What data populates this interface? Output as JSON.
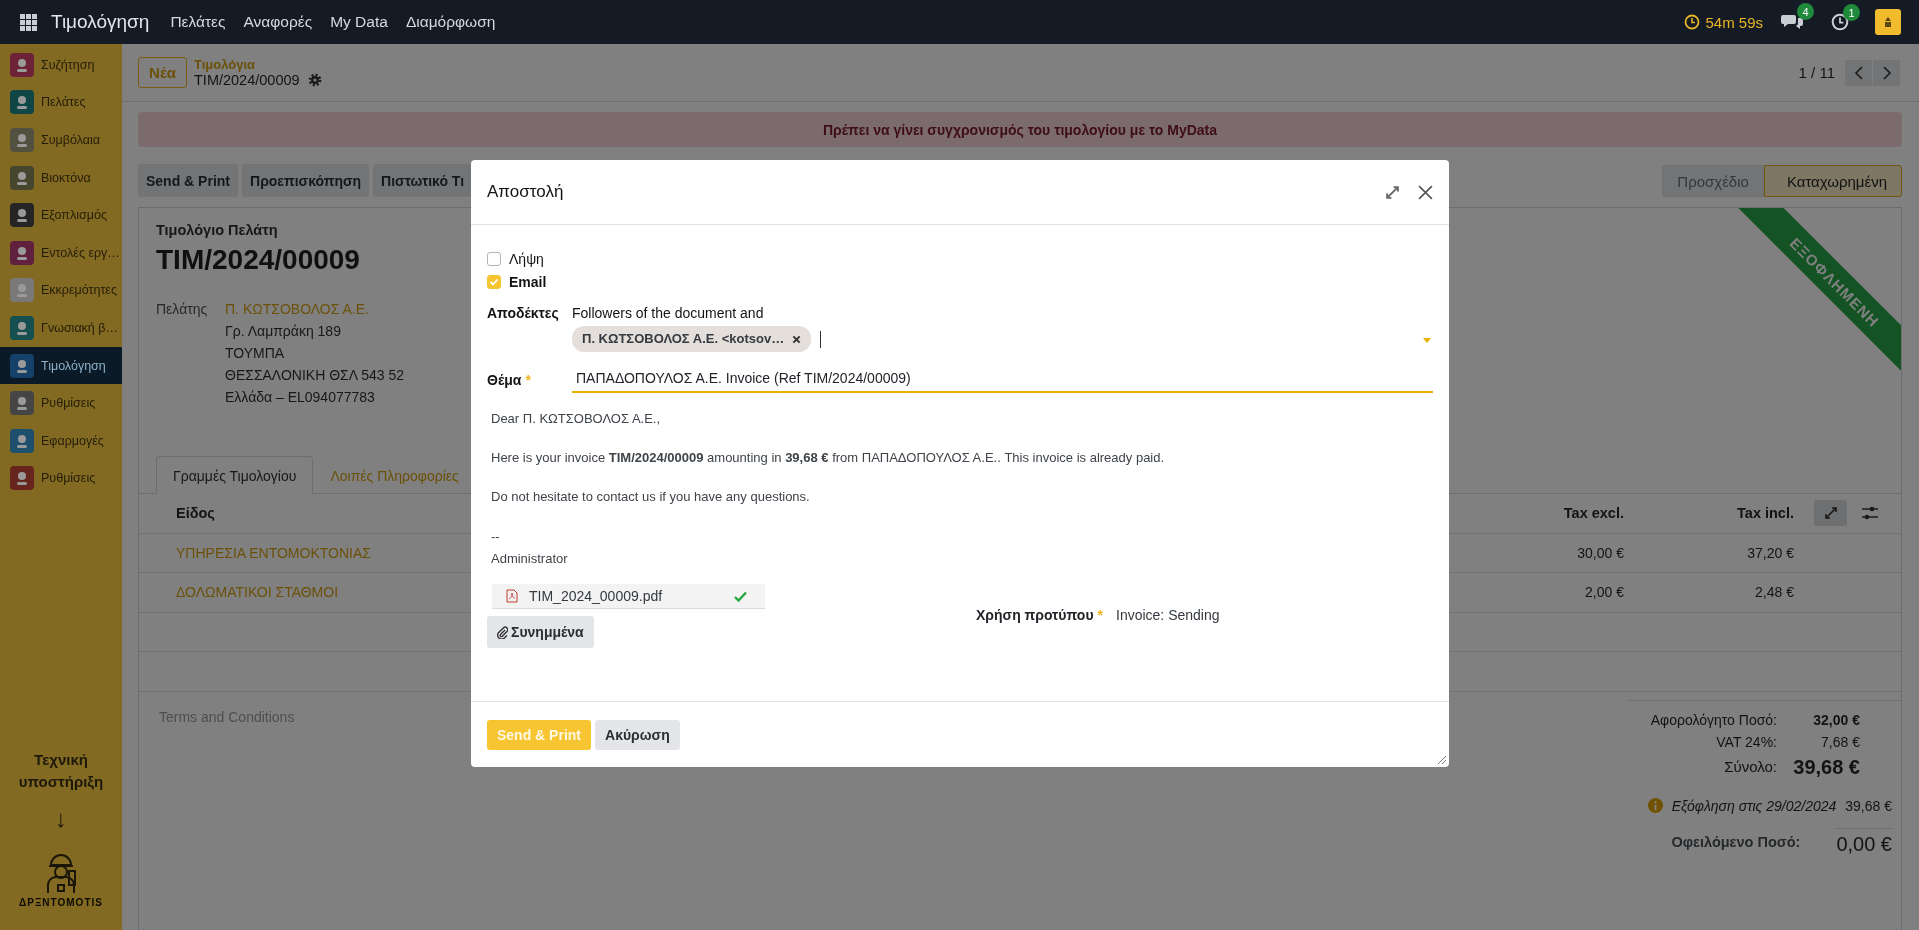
{
  "topbar": {
    "app_name": "Τιμολόγηση",
    "menu": [
      "Πελάτες",
      "Αναφορές",
      "My Data",
      "Διαμόρφωση"
    ],
    "timer": "54m 59s",
    "messages_count": "4",
    "activities_count": "1"
  },
  "sidebar": {
    "items": [
      {
        "label": "Συζήτηση",
        "selected": false,
        "color": "#6d2238"
      },
      {
        "label": "Πελάτες",
        "selected": false,
        "color": "#0f4646"
      },
      {
        "label": "Συμβόλαια",
        "selected": false,
        "color": "#52503e"
      },
      {
        "label": "Βιοκτόνα",
        "selected": false,
        "color": "#46452d"
      },
      {
        "label": "Εξοπλισμός",
        "selected": false,
        "color": "#252525"
      },
      {
        "label": "Εντολές εργ…",
        "selected": false,
        "color": "#61203d"
      },
      {
        "label": "Εκκρεμότητες",
        "selected": false,
        "color": "#797979"
      },
      {
        "label": "Γνωσιακή β…",
        "selected": false,
        "color": "#154f4f"
      },
      {
        "label": "Τιμολόγηση",
        "selected": true,
        "color": "#154069"
      },
      {
        "label": "Ρυθμίσεις",
        "selected": false,
        "color": "#454545"
      },
      {
        "label": "Εφαρμογές",
        "selected": false,
        "color": "#1d506c"
      },
      {
        "label": "Ρυθμίσεις",
        "selected": false,
        "color": "#68251d"
      }
    ],
    "support_text": "Τεχνική υποστήριξη",
    "support_arrow": "↓",
    "logo_text": "ΔΡΞΝΤΟΜΟΤΙS"
  },
  "control_panel": {
    "new_button": "Νέα",
    "breadcrumb_parent": "Τιμολόγια",
    "record_name": "TIM/2024/00009",
    "pager": "1 / 11"
  },
  "alert": "Πρέπει να γίνει συγχρονισμός του τιμολογίου με το MyData",
  "action_buttons": [
    "Send & Print",
    "Προεπισκόπηση",
    "Πιστωτικό Τι"
  ],
  "status": [
    {
      "label": "Προσχέδιο",
      "selected": false
    },
    {
      "label": "Καταχωρημένη",
      "selected": true
    }
  ],
  "invoice": {
    "doc_type": "Τιμολόγιο Πελάτη",
    "number": "TIM/2024/00009",
    "ribbon": "ΕΞΟΦΛΗΜΕΝΗ",
    "customer_label": "Πελάτης",
    "customer_name": "Π. ΚΩΤΣΟΒΟΛΟΣ Α.Ε.",
    "address": [
      "Γρ. Λαμπράκη 189",
      "ΤΟΥΜΠΑ",
      "ΘΕΣΣΑΛΟΝΙΚΗ ΘΣΛ 543 52",
      "Ελλάδα – EL094077783"
    ]
  },
  "tabs": [
    {
      "label": "Γραμμές Τιμολογίου",
      "selected": true
    },
    {
      "label": "Λοιπές Πληροφορίες",
      "selected": false
    }
  ],
  "table": {
    "columns": [
      "Είδος",
      "Tax excl.",
      "Tax incl."
    ],
    "rows": [
      {
        "product": "ΥΠΗΡΕΣΙΑ ΕΝΤΟΜΟΚΤΟΝΙΑΣ",
        "tax_excl": "30,00 €",
        "tax_incl": "37,20 €"
      },
      {
        "product": "ΔΟΛΩΜΑΤΙΚΟΙ ΣΤΑΘΜΟΙ",
        "tax_excl": "2,00 €",
        "tax_incl": "2,48 €"
      }
    ]
  },
  "terms_placeholder": "Terms and Conditions",
  "totals": {
    "lines": [
      {
        "label": "Αφορολόγητο Ποσό:",
        "value": "32,00 €",
        "kind": "subtotal"
      },
      {
        "label": "VAT 24%:",
        "value": "7,68 €",
        "kind": "tax"
      },
      {
        "label": "Σύνολο:",
        "value": "39,68 €",
        "kind": "total"
      }
    ],
    "payment": {
      "label": "Εξόφληση στις 29/02/2024",
      "value": "39,68 €"
    },
    "due_label": "Οφειλόμενο Ποσό:",
    "due_value": "0,00 €"
  },
  "modal": {
    "title": "Αποστολή",
    "options": [
      {
        "label": "Λήψη",
        "checked": false
      },
      {
        "label": "Email",
        "checked": true
      }
    ],
    "recipients_label": "Αποδέκτες",
    "recipients_intro": "Followers of the document and",
    "recipient_tags": [
      "Π. ΚΩΤΣΟΒΟΛΟΣ Α.Ε. <kotsov…"
    ],
    "subject_label": "Θέμα",
    "subject_required_mark": "*",
    "subject_value": "ΠΑΠΑΔΟΠΟΥΛΟΣ Α.Ε. Invoice (Ref TIM/2024/00009)",
    "body": [
      "Dear Π. ΚΩΤΣΟΒΟΛΟΣ Α.Ε.,",
      "Here is your invoice **TIM/2024/00009** amounting in **39,68 €** from ΠΑΠΑΔΟΠΟΥΛΟΣ Α.Ε.. This invoice is already paid.",
      "Do not hesitate to contact us if you have any questions."
    ],
    "signature": [
      "--",
      "Administrator"
    ],
    "attachment": "TIM_2024_00009.pdf",
    "attach_button": "Συνημμένα",
    "template_label": "Χρήση προτύπου",
    "template_required_mark": "*",
    "template_value": "Invoice: Sending",
    "buttons": [
      {
        "label": "Send & Print",
        "kind": "primary"
      },
      {
        "label": "Ακύρωση",
        "kind": "secondary"
      }
    ]
  }
}
